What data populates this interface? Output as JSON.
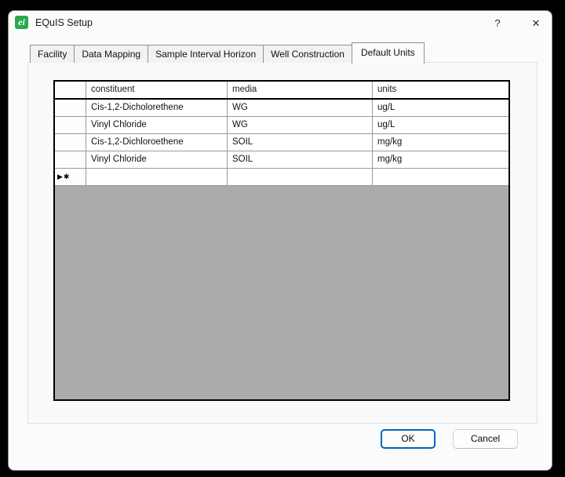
{
  "window": {
    "title": "EQuIS Setup",
    "icon_glyph": "ei",
    "help_glyph": "?",
    "close_glyph": "✕"
  },
  "tabs": {
    "items": [
      {
        "label": "Facility",
        "selected": false
      },
      {
        "label": "Data Mapping",
        "selected": false
      },
      {
        "label": "Sample Interval Horizon",
        "selected": false
      },
      {
        "label": "Well Construction",
        "selected": false
      },
      {
        "label": "Default Units",
        "selected": true
      }
    ]
  },
  "grid": {
    "columns": [
      "constituent",
      "media",
      "units"
    ],
    "rows": [
      {
        "constituent": "Cis-1,2-Dicholorethene",
        "media": "WG",
        "units": "ug/L"
      },
      {
        "constituent": "Vinyl Chloride",
        "media": "WG",
        "units": "ug/L"
      },
      {
        "constituent": "Cis-1,2-Dichloroethene",
        "media": "SOIL",
        "units": "mg/kg"
      },
      {
        "constituent": "Vinyl Chloride",
        "media": "SOIL",
        "units": "mg/kg"
      }
    ],
    "new_row": {
      "indicator": "▶✱",
      "constituent": "",
      "media": "",
      "units": ""
    }
  },
  "footer": {
    "ok_label": "OK",
    "cancel_label": "Cancel"
  },
  "colors": {
    "accent_button_border": "#0067c0",
    "logo_green": "#2aa84e",
    "grid_empty_gray": "#ababab"
  }
}
